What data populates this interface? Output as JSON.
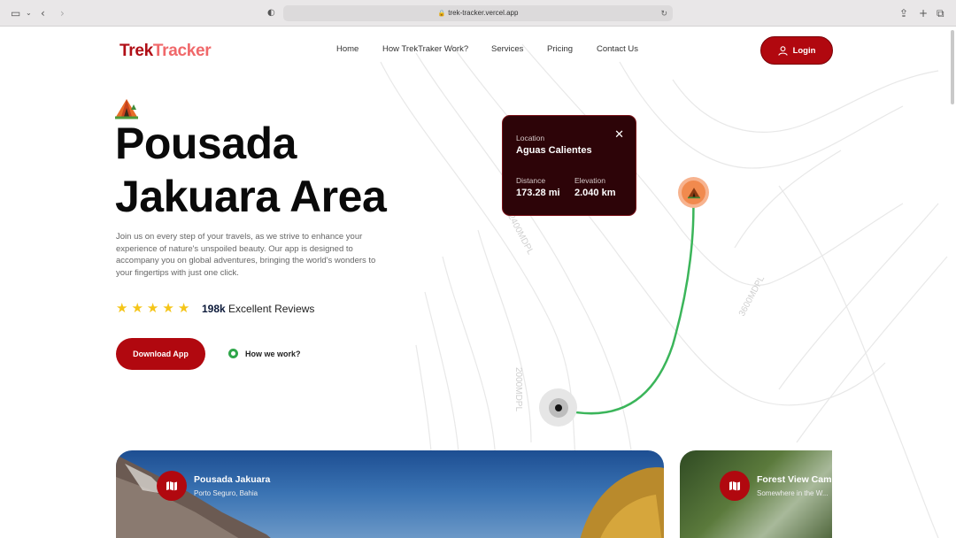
{
  "browser": {
    "url": "trek-tracker.vercel.app"
  },
  "header": {
    "logo_part1": "Trek",
    "logo_part2": "Tracker",
    "nav": [
      "Home",
      "How TrekTraker Work?",
      "Services",
      "Pricing",
      "Contact Us"
    ],
    "login_label": "Login"
  },
  "hero": {
    "title_line1": "Pousada",
    "title_line2": "Jakuara Area",
    "description": "Join us on every step of your travels, as we strive to enhance your experience of nature's unspoiled beauty. Our app is designed to accompany you on global adventures, bringing the world's wonders to your fingertips with just one click.",
    "rating_stars": 5,
    "reviews_count": "198k",
    "reviews_label": "Excellent Reviews",
    "download_label": "Download App",
    "how_label": "How we work?"
  },
  "map": {
    "contour_labels": [
      "2400MDPL",
      "3600MDPL",
      "2000MDPL"
    ],
    "location_label": "Location",
    "location_value": "Aguas Calientes",
    "distance_label": "Distance",
    "distance_value": "173.28 mi",
    "elevation_label": "Elevation",
    "elevation_value": "2.040 km"
  },
  "cards": [
    {
      "title": "Pousada Jakuara",
      "subtitle": "Porto Seguro, Bahia"
    },
    {
      "title": "Forest View Camp",
      "subtitle": "Somewhere in the W..."
    }
  ],
  "colors": {
    "brand_red": "#b1080f",
    "logo_light": "#f0686a",
    "route_green": "#3bb55a",
    "card_dark": "#2d0408"
  }
}
